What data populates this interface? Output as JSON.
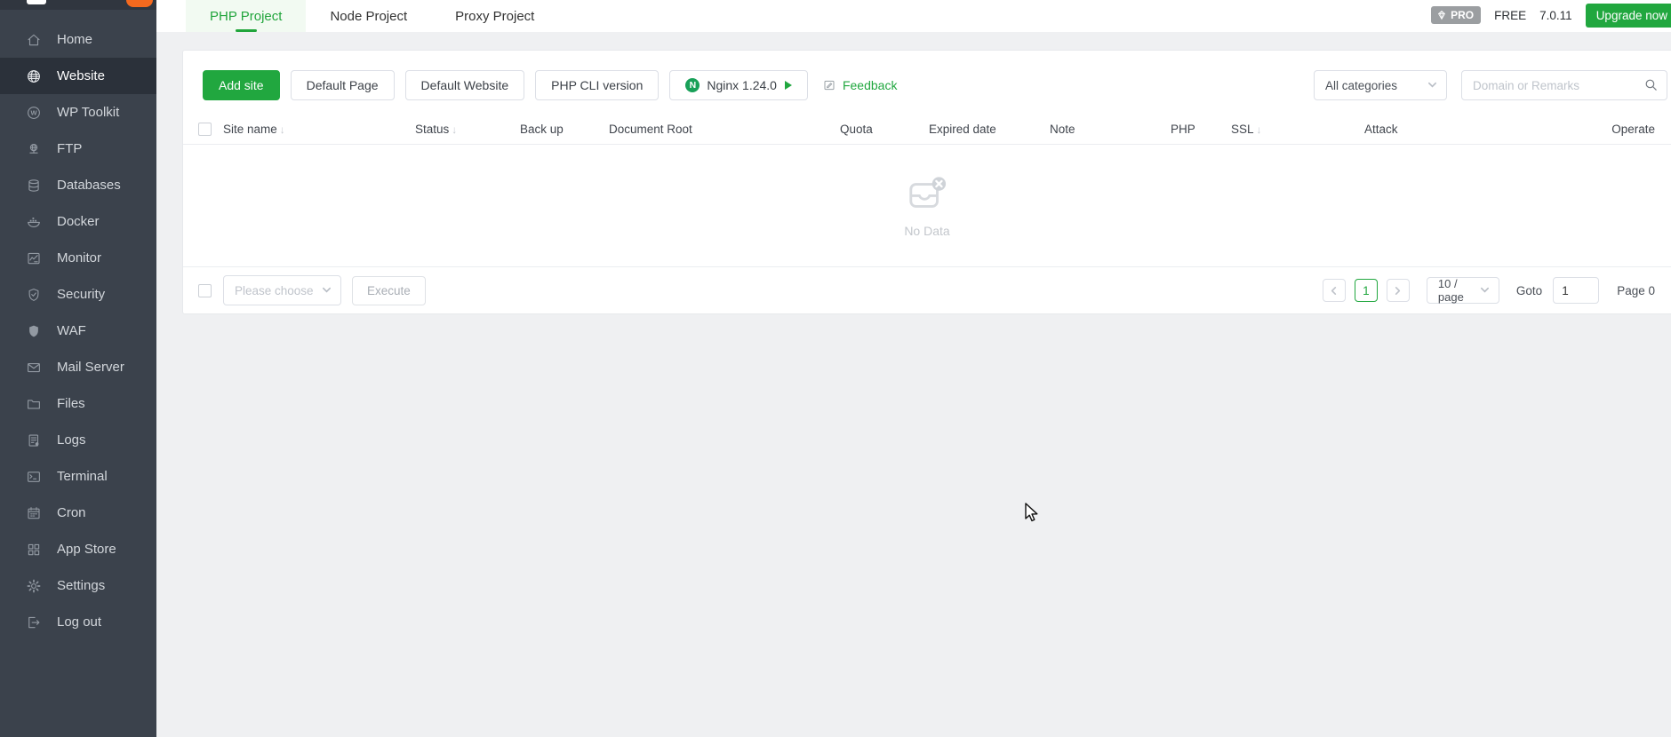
{
  "sidebar": {
    "items": [
      {
        "label": "Home",
        "icon": "home-icon"
      },
      {
        "label": "Website",
        "icon": "globe-icon"
      },
      {
        "label": "WP Toolkit",
        "icon": "wordpress-icon"
      },
      {
        "label": "FTP",
        "icon": "ftp-globe-icon"
      },
      {
        "label": "Databases",
        "icon": "database-icon"
      },
      {
        "label": "Docker",
        "icon": "docker-whale-icon"
      },
      {
        "label": "Monitor",
        "icon": "monitor-chart-icon"
      },
      {
        "label": "Security",
        "icon": "shield-check-icon"
      },
      {
        "label": "WAF",
        "icon": "shield-filled-icon"
      },
      {
        "label": "Mail Server",
        "icon": "mail-envelope-icon"
      },
      {
        "label": "Files",
        "icon": "folder-icon"
      },
      {
        "label": "Logs",
        "icon": "log-document-icon"
      },
      {
        "label": "Terminal",
        "icon": "terminal-icon"
      },
      {
        "label": "Cron",
        "icon": "calendar-icon"
      },
      {
        "label": "App Store",
        "icon": "grid-icon"
      },
      {
        "label": "Settings",
        "icon": "gear-icon"
      },
      {
        "label": "Log out",
        "icon": "logout-icon"
      }
    ],
    "active_item": "Website"
  },
  "topbar": {
    "tabs": [
      {
        "label": "PHP Project"
      },
      {
        "label": "Node Project"
      },
      {
        "label": "Proxy Project"
      }
    ],
    "active_tab": "PHP Project",
    "pro_badge": "PRO",
    "plan": "FREE",
    "version": "7.0.11",
    "upgrade_label": "Upgrade now"
  },
  "toolbar": {
    "add_site": "Add site",
    "default_page": "Default Page",
    "default_website": "Default Website",
    "php_cli": "PHP CLI version",
    "nginx_label": "Nginx 1.24.0",
    "nginx_logo_letter": "N",
    "feedback": "Feedback",
    "category_filter": "All categories",
    "search_placeholder": "Domain or Remarks"
  },
  "table": {
    "columns": [
      {
        "label": "Site name",
        "sortable": true
      },
      {
        "label": "Status",
        "sortable": true
      },
      {
        "label": "Back up",
        "sortable": false
      },
      {
        "label": "Document Root",
        "sortable": false
      },
      {
        "label": "Quota",
        "sortable": false
      },
      {
        "label": "Expired date",
        "sortable": false
      },
      {
        "label": "Note",
        "sortable": false
      },
      {
        "label": "PHP",
        "sortable": false
      },
      {
        "label": "SSL",
        "sortable": true
      },
      {
        "label": "Attack",
        "sortable": false
      },
      {
        "label": "Operate",
        "sortable": false
      }
    ],
    "sort_arrow": "↓",
    "rows": [],
    "empty_text": "No Data"
  },
  "footer": {
    "batch_placeholder": "Please choose",
    "execute_label": "Execute",
    "pagination": {
      "current_page": "1",
      "per_page": "10 / page",
      "goto_label": "Goto",
      "goto_value": "1",
      "page_info": "Page 0"
    }
  },
  "colors": {
    "accent_green": "#21a73f",
    "sidebar_bg": "#3b424c",
    "sidebar_active_bg": "#2b313a",
    "trial_badge_orange": "#f4691e",
    "pro_badge_gray": "#9b9ea1",
    "content_bg": "#eff0f2"
  }
}
